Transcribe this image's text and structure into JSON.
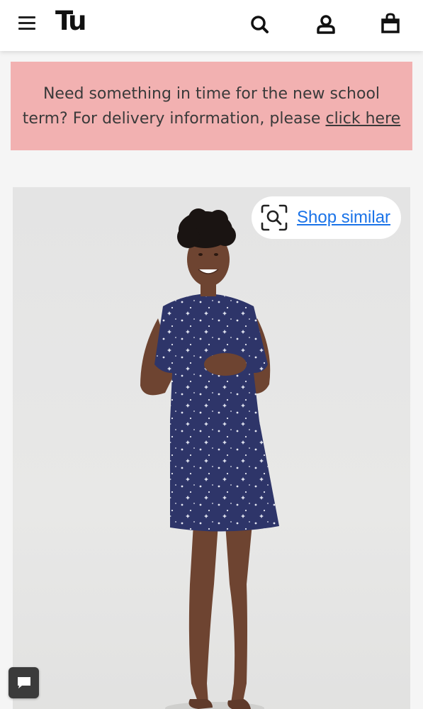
{
  "header": {
    "logo_text": "Tu",
    "icons": [
      "menu-icon",
      "search-icon",
      "account-icon",
      "bag-icon"
    ]
  },
  "promo": {
    "text": "Need something in time for the new school term? For delivery information, please",
    "link_text": "click here",
    "background": "#f2b1b1"
  },
  "product": {
    "shop_similar_label": "Shop similar",
    "shop_similar_icon": "visual-search-icon",
    "link_color": "#1a73e8"
  },
  "chat": {
    "icon": "chat-icon"
  }
}
